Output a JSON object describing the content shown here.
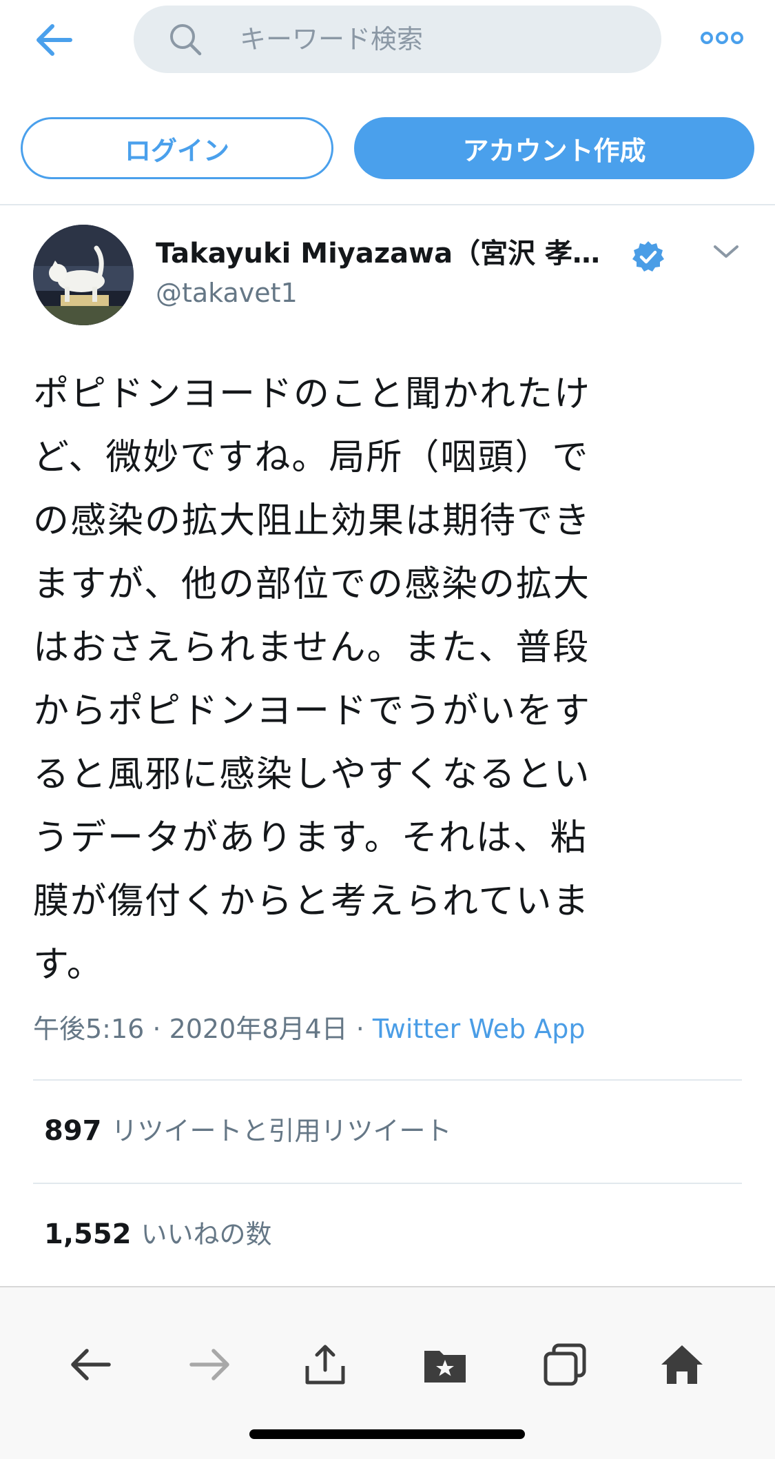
{
  "header": {
    "search_placeholder": "キーワード検索",
    "back_icon": "arrow-left-icon",
    "more_icon": "ellipsis-icon"
  },
  "auth": {
    "login_label": "ログイン",
    "signup_label": "アカウント作成"
  },
  "tweet": {
    "author_name": "Takayuki Miyazawa（宮沢 孝…",
    "author_handle": "@takavet1",
    "verified": true,
    "text": "ポピドンヨードのこと聞かれたけ\nど、微妙ですね。局所（咽頭）で\nの感染の拡大阻止効果は期待でき\nますが、他の部位での感染の拡大\nはおさえられません。また、普段\nからポピドンヨードでうがいをす\nると風邪に感染しやすくなるとい\nうデータがあります。それは、粘\n膜が傷付くからと考えられていま\nす。",
    "time": "午後5:16 · 2020年8月4日 · ",
    "source": "Twitter Web App"
  },
  "stats": {
    "retweets_count": "897",
    "retweets_label": "リツイートと引用リツイート",
    "likes_count": "1,552",
    "likes_label": "いいねの数"
  },
  "colors": {
    "accent": "#4aa0ec",
    "link": "#4a9de6",
    "muted": "#657786"
  },
  "bottom_bar": {
    "icons": [
      "back-arrow-icon",
      "forward-arrow-icon",
      "share-icon",
      "bookmarks-icon",
      "tabs-icon",
      "home-icon"
    ]
  }
}
